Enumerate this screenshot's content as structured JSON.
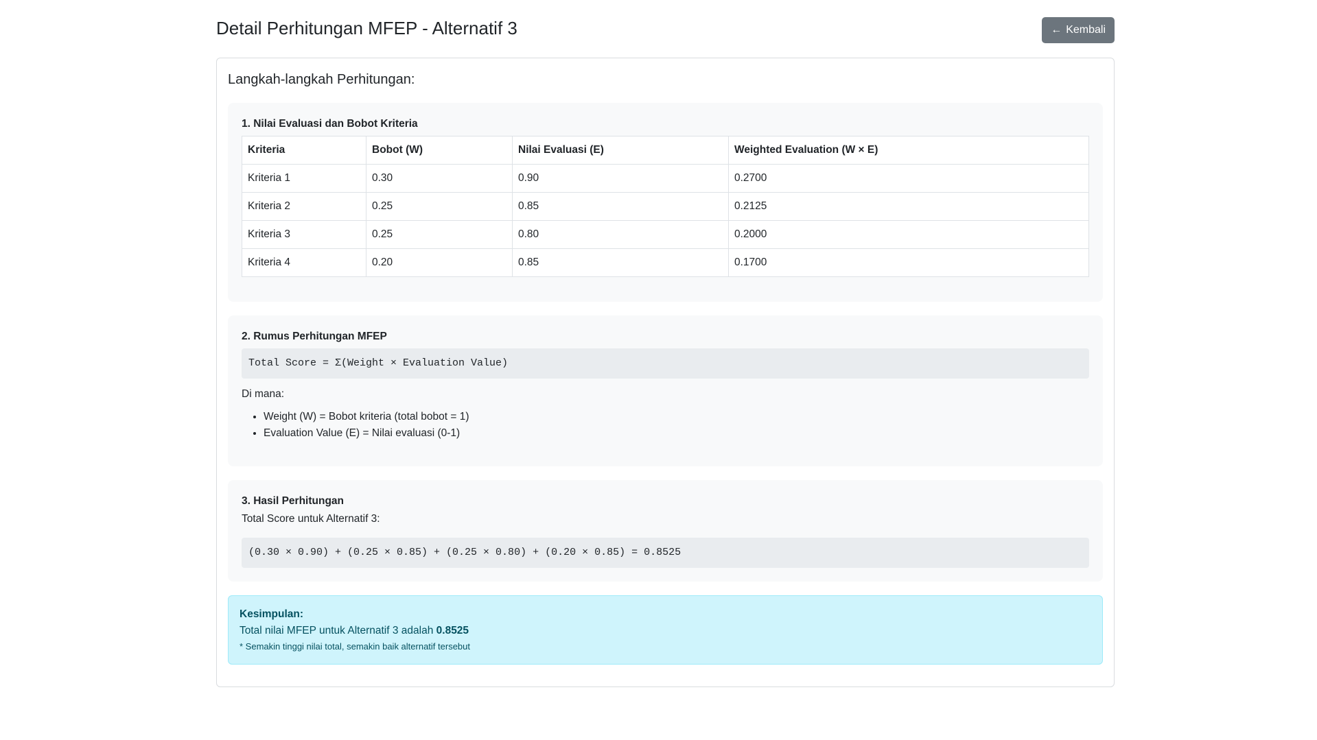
{
  "header": {
    "title": "Detail Perhitungan MFEP - Alternatif 3",
    "back_icon": "←",
    "back_label": "Kembali"
  },
  "card": {
    "title": "Langkah-langkah Perhitungan:"
  },
  "section1": {
    "title": "1. Nilai Evaluasi dan Bobot Kriteria",
    "headers": [
      "Kriteria",
      "Bobot (W)",
      "Nilai Evaluasi (E)",
      "Weighted Evaluation (W × E)"
    ],
    "rows": [
      [
        "Kriteria 1",
        "0.30",
        "0.90",
        "0.2700"
      ],
      [
        "Kriteria 2",
        "0.25",
        "0.85",
        "0.2125"
      ],
      [
        "Kriteria 3",
        "0.25",
        "0.80",
        "0.2000"
      ],
      [
        "Kriteria 4",
        "0.20",
        "0.85",
        "0.1700"
      ]
    ]
  },
  "section2": {
    "title": "2. Rumus Perhitungan MFEP",
    "formula": "Total Score = Σ(Weight × Evaluation Value)",
    "where": "Di mana:",
    "items": [
      "Weight (W) = Bobot kriteria (total bobot = 1)",
      "Evaluation Value (E) = Nilai evaluasi (0-1)"
    ]
  },
  "section3": {
    "title": "3. Hasil Perhitungan",
    "label": "Total Score untuk Alternatif 3:",
    "calculation": "(0.30 × 0.90) + (0.25 × 0.85) + (0.25 × 0.80) + (0.20 × 0.85) = 0.8525"
  },
  "conclusion": {
    "title": "Kesimpulan:",
    "text": "Total nilai MFEP untuk Alternatif 3 adalah ",
    "value": "0.8525",
    "note": "* Semakin tinggi nilai total, semakin baik alternatif tersebut"
  },
  "colors": {
    "button_bg": "#6c757d",
    "alert_bg": "#cff4fc",
    "alert_text": "#055160",
    "section_bg": "#f8f9fa"
  }
}
